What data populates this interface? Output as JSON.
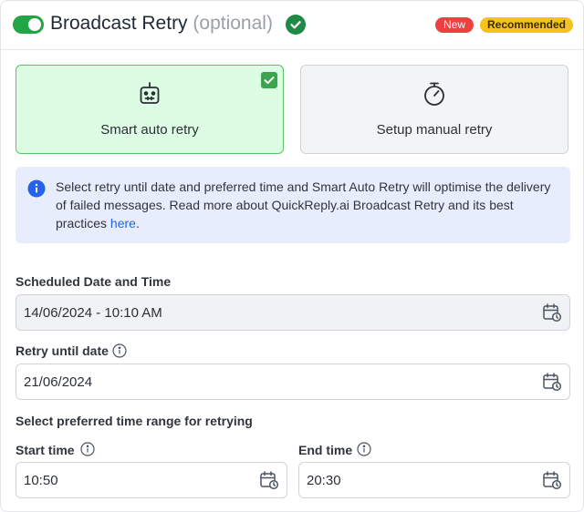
{
  "header": {
    "title": "Broadcast Retry",
    "optional": "(optional)",
    "badge_new": "New",
    "badge_recommended": "Recommended",
    "toggle_on": true
  },
  "options": {
    "smart": {
      "label": "Smart auto retry",
      "icon": "robot-icon",
      "selected": true
    },
    "manual": {
      "label": "Setup manual retry",
      "icon": "stopwatch-icon",
      "selected": false
    }
  },
  "info": {
    "text": "Select retry until date and preferred time and Smart Auto Retry will optimise the delivery of failed messages. Read more about QuickReply.ai Broadcast Retry and its best practices ",
    "link": "here",
    "suffix": "."
  },
  "scheduled": {
    "label": "Scheduled Date and Time",
    "value": "14/06/2024 - 10:10 AM"
  },
  "retry_until": {
    "label": "Retry until date",
    "value": "21/06/2024"
  },
  "time_range": {
    "label": "Select preferred time range for retrying",
    "start": {
      "label": "Start time",
      "value": "10:50"
    },
    "end": {
      "label": "End time",
      "value": "20:30"
    }
  },
  "colors": {
    "accent_green": "#22a447",
    "selected_bg": "#dcfde3",
    "info_bg": "#e8edfd",
    "info_blue": "#2563eb",
    "badge_red": "#ef3f3f",
    "badge_yellow": "#f6c21c"
  }
}
